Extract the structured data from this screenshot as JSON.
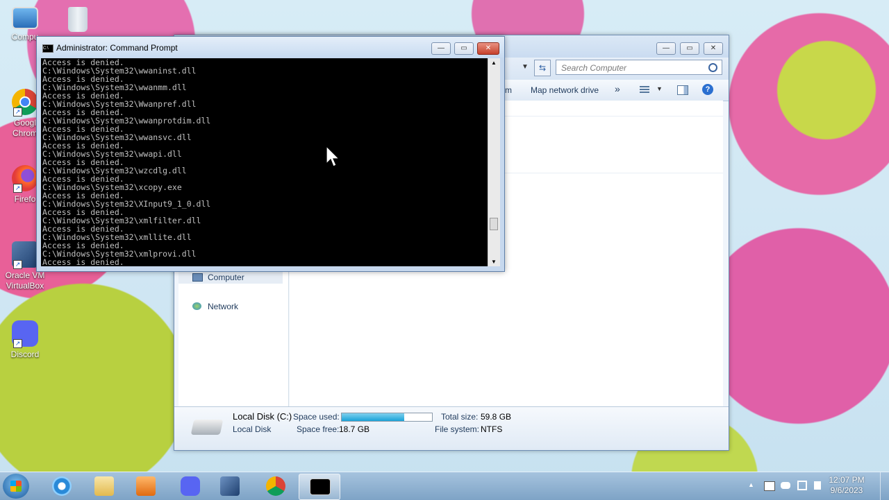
{
  "desktop": {
    "icons": [
      {
        "label": "Compu",
        "icon": "computer-icon"
      },
      {
        "label": "",
        "icon": "recycle-bin-icon"
      },
      {
        "label": "Googl Chrom",
        "icon": "chrome-icon"
      },
      {
        "label": "Firefo",
        "icon": "firefox-icon"
      },
      {
        "label": "Oracle VM VirtualBox",
        "icon": "virtualbox-icon"
      },
      {
        "label": "Discord",
        "icon": "discord-icon"
      }
    ]
  },
  "explorer": {
    "search_placeholder": "Search Computer",
    "toolbar": {
      "partial_item": "m",
      "map_network": "Map network drive",
      "more": "»"
    },
    "nav": {
      "computer": "Computer",
      "network": "Network"
    },
    "details": {
      "drive_name": "Local Disk (C:)",
      "drive_type": "Local Disk",
      "space_used_label": "Space used:",
      "space_used_fraction": 0.69,
      "space_free_label": "Space free:",
      "space_free": "18.7 GB",
      "total_size_label": "Total size:",
      "total_size": "59.8 GB",
      "file_system_label": "File system:",
      "file_system": "NTFS"
    }
  },
  "cmd": {
    "title": "Administrator:  Command Prompt",
    "lines": [
      "Access is denied.",
      "C:\\Windows\\System32\\wwaninst.dll",
      "Access is denied.",
      "C:\\Windows\\System32\\wwanmm.dll",
      "Access is denied.",
      "C:\\Windows\\System32\\Wwanpref.dll",
      "Access is denied.",
      "C:\\Windows\\System32\\wwanprotdim.dll",
      "Access is denied.",
      "C:\\Windows\\System32\\wwansvc.dll",
      "Access is denied.",
      "C:\\Windows\\System32\\wwapi.dll",
      "Access is denied.",
      "C:\\Windows\\System32\\wzcdlg.dll",
      "Access is denied.",
      "C:\\Windows\\System32\\xcopy.exe",
      "Access is denied.",
      "C:\\Windows\\System32\\XInput9_1_0.dll",
      "Access is denied.",
      "C:\\Windows\\System32\\xmlfilter.dll",
      "Access is denied.",
      "C:\\Windows\\System32\\xmllite.dll",
      "Access is denied.",
      "C:\\Windows\\System32\\xmlprovi.dll",
      "Access is denied."
    ]
  },
  "taskbar": {
    "apps": [
      "internet-explorer-icon",
      "file-explorer-icon",
      "media-player-icon",
      "discord-icon",
      "virtualbox-icon",
      "chrome-icon",
      "command-prompt-icon"
    ],
    "clock_time": "12:07 PM",
    "clock_date": "9/6/2023",
    "tray_expand": "▲"
  },
  "colors": {
    "console_bg": "#000000",
    "console_fg": "#c0c0c0",
    "disk_bar": "#1aa3d8"
  }
}
